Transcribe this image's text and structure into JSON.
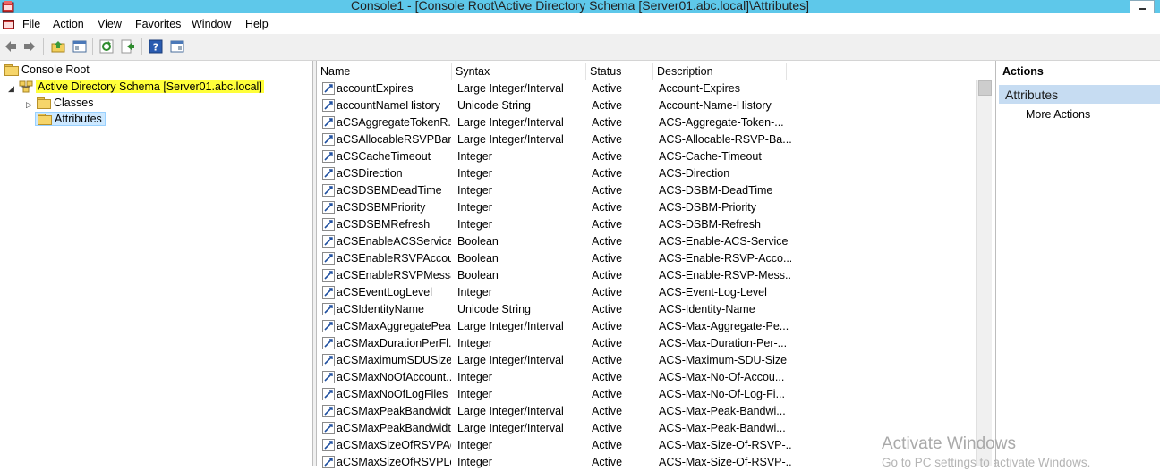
{
  "window": {
    "title": "Console1 - [Console Root\\Active Directory Schema [Server01.abc.local]\\Attributes]"
  },
  "menu": [
    "File",
    "Action",
    "View",
    "Favorites",
    "Window",
    "Help"
  ],
  "toolbar": [
    "back-icon",
    "forward-icon",
    "up-folder-icon",
    "show-hide-tree-icon",
    "refresh-icon",
    "export-list-icon",
    "help-icon",
    "show-hide-action-pane-icon"
  ],
  "tree": {
    "root": "Console Root",
    "schema": "Active Directory Schema [Server01.abc.local]",
    "classes": "Classes",
    "attributes": "Attributes"
  },
  "list": {
    "columns": [
      "Name",
      "Syntax",
      "Status",
      "Description"
    ],
    "rows": [
      {
        "name": "accountExpires",
        "syntax": "Large Integer/Interval",
        "status": "Active",
        "desc": "Account-Expires"
      },
      {
        "name": "accountNameHistory",
        "syntax": "Unicode String",
        "status": "Active",
        "desc": "Account-Name-History"
      },
      {
        "name": "aCSAggregateTokenR...",
        "syntax": "Large Integer/Interval",
        "status": "Active",
        "desc": "ACS-Aggregate-Token-..."
      },
      {
        "name": "aCSAllocableRSVPBan...",
        "syntax": "Large Integer/Interval",
        "status": "Active",
        "desc": "ACS-Allocable-RSVP-Ba..."
      },
      {
        "name": "aCSCacheTimeout",
        "syntax": "Integer",
        "status": "Active",
        "desc": "ACS-Cache-Timeout"
      },
      {
        "name": "aCSDirection",
        "syntax": "Integer",
        "status": "Active",
        "desc": "ACS-Direction"
      },
      {
        "name": "aCSDSBMDeadTime",
        "syntax": "Integer",
        "status": "Active",
        "desc": "ACS-DSBM-DeadTime"
      },
      {
        "name": "aCSDSBMPriority",
        "syntax": "Integer",
        "status": "Active",
        "desc": "ACS-DSBM-Priority"
      },
      {
        "name": "aCSDSBMRefresh",
        "syntax": "Integer",
        "status": "Active",
        "desc": "ACS-DSBM-Refresh"
      },
      {
        "name": "aCSEnableACSService",
        "syntax": "Boolean",
        "status": "Active",
        "desc": "ACS-Enable-ACS-Service"
      },
      {
        "name": "aCSEnableRSVPAccou...",
        "syntax": "Boolean",
        "status": "Active",
        "desc": "ACS-Enable-RSVP-Acco..."
      },
      {
        "name": "aCSEnableRSVPMessa...",
        "syntax": "Boolean",
        "status": "Active",
        "desc": "ACS-Enable-RSVP-Mess..."
      },
      {
        "name": "aCSEventLogLevel",
        "syntax": "Integer",
        "status": "Active",
        "desc": "ACS-Event-Log-Level"
      },
      {
        "name": "aCSIdentityName",
        "syntax": "Unicode String",
        "status": "Active",
        "desc": "ACS-Identity-Name"
      },
      {
        "name": "aCSMaxAggregatePea...",
        "syntax": "Large Integer/Interval",
        "status": "Active",
        "desc": "ACS-Max-Aggregate-Pe..."
      },
      {
        "name": "aCSMaxDurationPerFl...",
        "syntax": "Integer",
        "status": "Active",
        "desc": "ACS-Max-Duration-Per-..."
      },
      {
        "name": "aCSMaximumSDUSize",
        "syntax": "Large Integer/Interval",
        "status": "Active",
        "desc": "ACS-Maximum-SDU-Size"
      },
      {
        "name": "aCSMaxNoOfAccount...",
        "syntax": "Integer",
        "status": "Active",
        "desc": "ACS-Max-No-Of-Accou..."
      },
      {
        "name": "aCSMaxNoOfLogFiles",
        "syntax": "Integer",
        "status": "Active",
        "desc": "ACS-Max-No-Of-Log-Fi..."
      },
      {
        "name": "aCSMaxPeakBandwidth",
        "syntax": "Large Integer/Interval",
        "status": "Active",
        "desc": "ACS-Max-Peak-Bandwi..."
      },
      {
        "name": "aCSMaxPeakBandwidt...",
        "syntax": "Large Integer/Interval",
        "status": "Active",
        "desc": "ACS-Max-Peak-Bandwi..."
      },
      {
        "name": "aCSMaxSizeOfRSVPAc...",
        "syntax": "Integer",
        "status": "Active",
        "desc": "ACS-Max-Size-Of-RSVP-..."
      },
      {
        "name": "aCSMaxSizeOfRSVPLo...",
        "syntax": "Integer",
        "status": "Active",
        "desc": "ACS-Max-Size-Of-RSVP-..."
      }
    ]
  },
  "actions": {
    "header": "Actions",
    "section": "Attributes",
    "item": "More Actions"
  },
  "watermark": {
    "line1": "Activate Windows",
    "line2": "Go to PC settings to activate Windows."
  },
  "colors": {
    "titlebar": "#5ec8ea",
    "highlight": "#ffff3a",
    "selection": "#cce8ff",
    "actions_section": "#c6dcf2"
  }
}
